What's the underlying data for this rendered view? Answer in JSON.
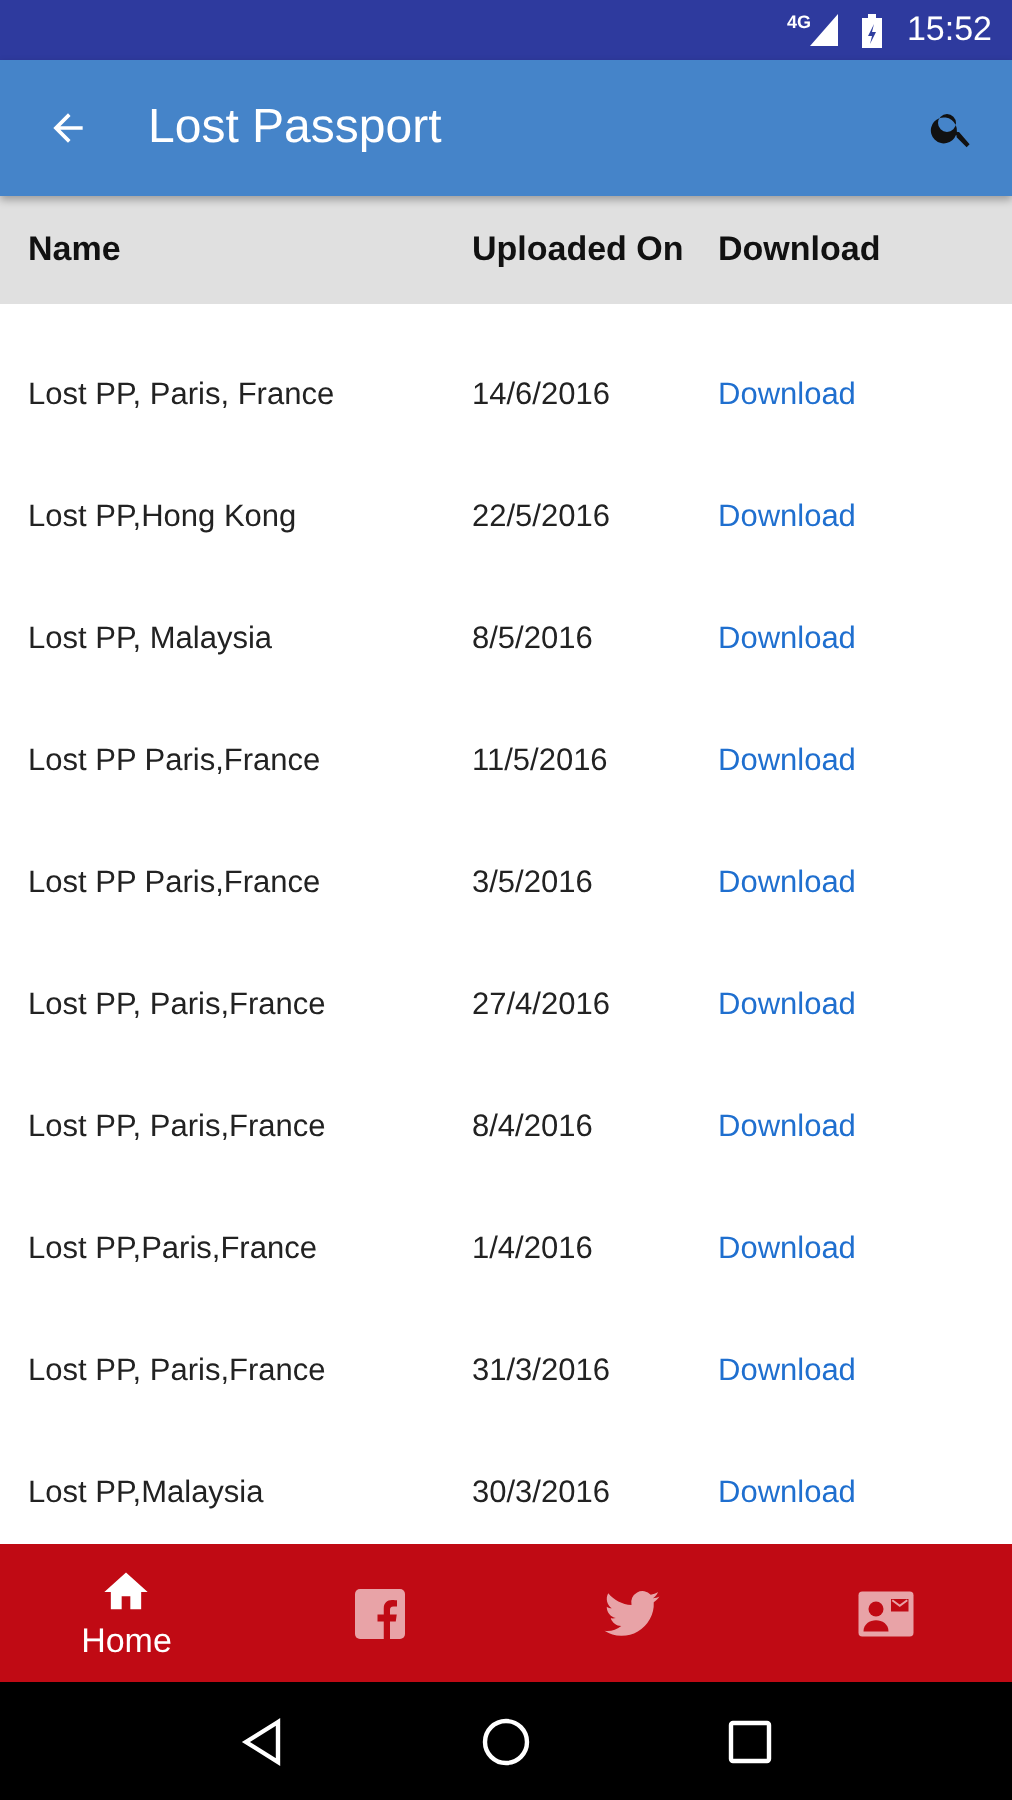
{
  "status_bar": {
    "network": "4G",
    "time": "15:52"
  },
  "app_bar": {
    "title": "Lost Passport"
  },
  "table": {
    "columns": [
      "Name",
      "Uploaded On",
      "Download"
    ],
    "rows": [
      {
        "name": "Lost PP, Paris, France",
        "date": "14/6/2016",
        "link": "Download"
      },
      {
        "name": "Lost PP,Hong Kong",
        "date": "22/5/2016",
        "link": "Download"
      },
      {
        "name": "Lost PP, Malaysia",
        "date": "8/5/2016",
        "link": "Download"
      },
      {
        "name": "Lost PP Paris,France",
        "date": "11/5/2016",
        "link": "Download"
      },
      {
        "name": "Lost PP Paris,France",
        "date": "3/5/2016",
        "link": "Download"
      },
      {
        "name": "Lost PP, Paris,France",
        "date": "27/4/2016",
        "link": "Download"
      },
      {
        "name": "Lost PP, Paris,France",
        "date": "8/4/2016",
        "link": "Download"
      },
      {
        "name": "Lost PP,Paris,France",
        "date": "1/4/2016",
        "link": "Download"
      },
      {
        "name": "Lost PP, Paris,France",
        "date": "31/3/2016",
        "link": "Download"
      },
      {
        "name": "Lost PP,Malaysia",
        "date": "30/3/2016",
        "link": "Download"
      }
    ]
  },
  "bottom_nav": [
    {
      "kind": "home",
      "label": "Home",
      "selected": true
    },
    {
      "kind": "facebook",
      "selected": false
    },
    {
      "kind": "twitter",
      "selected": false
    },
    {
      "kind": "contact",
      "selected": false
    }
  ]
}
